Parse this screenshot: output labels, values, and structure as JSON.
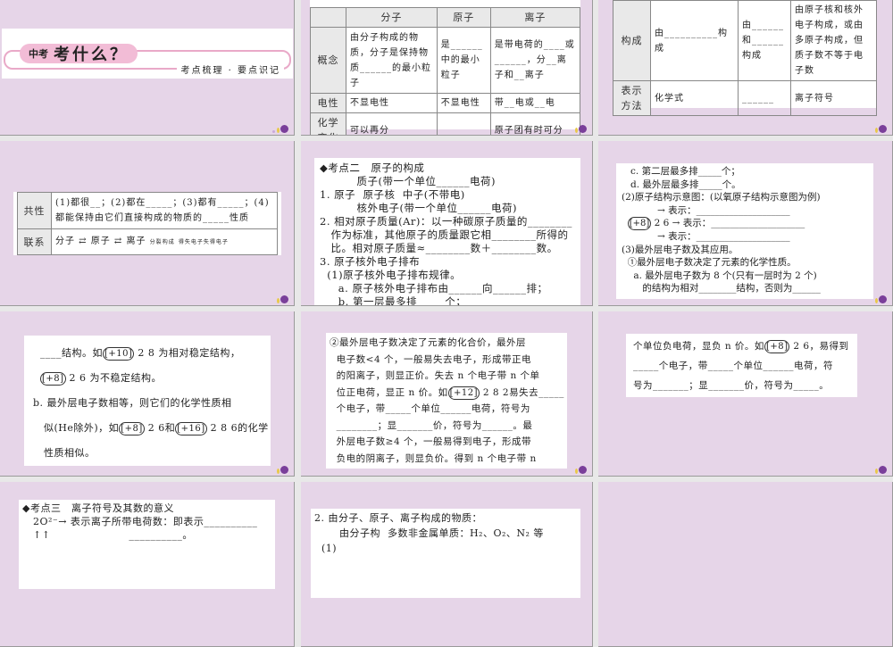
{
  "colors": {
    "slide_bg": "#e6d5e8",
    "accent_pink": "#f2bcd6",
    "gap": "#e8e8e8"
  },
  "s1": {
    "prefix": "中考",
    "title": "考什么？",
    "subtitle": "考点梳理 · 要点识记"
  },
  "s2": {
    "header": [
      "",
      "分子",
      "原子",
      "离子"
    ],
    "rows": [
      [
        "概念",
        "由分子构成的物质，分子是保持物质______的最小粒子",
        "是______中的最小粒子",
        "是带电荷的____或______，分__离子和__离子"
      ],
      [
        "电性",
        "不显电性",
        "不显电性",
        "带__电或__电"
      ],
      [
        "化学变化",
        "可以再分",
        "______",
        "原子团有时可分"
      ]
    ]
  },
  "s3": {
    "rows": [
      [
        "构成",
        "由__________构成",
        "由______和______构成",
        "由原子核和核外电子构成，或由多原子构成，但质子数不等于电子数"
      ],
      [
        "表示方法",
        "化学式",
        "______",
        "离子符号"
      ]
    ]
  },
  "s4": {
    "rows": [
      [
        "共性",
        "(1)都很__；(2)都在_____；(3)都有_____；(4)都能保持由它们直接构成的物质的_____性质"
      ],
      [
        "联系",
        "分子 ⇄ 原子 ⇄ 离子"
      ]
    ],
    "arrow1_top": "分裂",
    "arrow1_bottom": "构成",
    "arrow2_top": "得失电子",
    "arrow2_bottom": "失得电子"
  },
  "s5": {
    "lines": [
      "◆考点二　原子的构成",
      "          质子(带一个单位______电荷)",
      "1. 原子  原子核  中子(不带电)",
      "          核外电子(带一个单位______电荷)",
      "2. 相对原子质量(Ar)：以一种碳原子质量的________",
      "   作为标准，其他原子的质量跟它相________所得的",
      "   比。相对原子质量≈________数＋________数。",
      "3. 原子核外电子排布",
      "  (1)原子核外电子排布规律。",
      "     a. 原子核外电子排布由______向______排；",
      "     b. 第一层最多排_____个；"
    ]
  },
  "s6": {
    "lines": [
      "   c. 第二层最多排_____个；",
      "   d. 最外层最多排_____个。",
      "(2)原子结构示意图：(以氧原子结构示意图为例)",
      "            → 表示：____________________",
      "  [+8] 2 6 → 表示：____________________",
      "            → 表示：____________________",
      "(3)最外层电子数及其应用。",
      "  ①最外层电子数决定了元素的化学性质。",
      "    a. 最外层电子数为 8 个(只有一层时为 2 个)",
      "       的结构为相对________结构，否则为______"
    ]
  },
  "s7": {
    "lines": [
      "  ____结构。如[+10] 2 8 为相对稳定结构，",
      "  [+8] 2 6 为不稳定结构。",
      "b. 最外层电子数相等，则它们的化学性质相",
      "   似(He除外)，如[+8] 2 6和[+16] 2 8 6的化学",
      "   性质相似。"
    ]
  },
  "s8": {
    "lines": [
      "②最外层电子数决定了元素的化合价，最外层",
      "  电子数<4 个，一般易失去电子，形成带正电",
      "  的阳离子，则显正价。失去 n 个电子带 n 个单",
      "  位正电荷，显正 n 价。如[+12] 2 8 2易失去_____",
      "  个电子，带_____个单位______电荷，符号为",
      "  ________；显_______价，符号为______。最",
      "  外层电子数≥4 个，一般易得到电子，形成带",
      "  负电的阴离子，则显负价。得到 n 个电子带 n"
    ]
  },
  "s9": {
    "lines": [
      "个单位负电荷，显负 n 价。如[+8] 2 6，易得到",
      "_____个电子，带_____个单位______电荷，符",
      "号为_______；显_______价，符号为_____。"
    ]
  },
  "s10": {
    "lines": [
      "◆考点三　离子符号及其数的意义",
      "   2O²⁻→ 表示离子所带电荷数：即表示__________",
      "   ↑↑                      __________。"
    ]
  },
  "s11": {
    "lines": [
      "2. 由分子、原子、离子构成的物质：",
      "       由分子构  多数非金属单质：H₂、O₂、N₂ 等",
      "  (1)"
    ]
  }
}
